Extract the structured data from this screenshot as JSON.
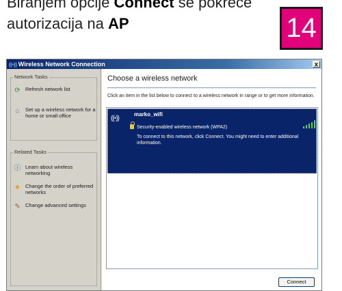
{
  "caption": {
    "line1_pre": "Biranjem opcije ",
    "line1_kw": "Connect",
    "line1_post": " se pokreće",
    "line2_pre": "autorizacija na ",
    "line2_kw": "AP"
  },
  "step_number": "14",
  "window": {
    "title": "Wireless Network Connection",
    "close_glyph": "x"
  },
  "sidebar": {
    "network_tasks": {
      "header": "Network Tasks",
      "items": [
        {
          "label": "Refresh network list",
          "icon": "refresh-icon"
        },
        {
          "label": "Set up a wireless network for a home or small office",
          "icon": "setup-network-icon"
        }
      ]
    },
    "related_tasks": {
      "header": "Related Tasks",
      "items": [
        {
          "label": "Learn about wireless networking",
          "icon": "info-icon"
        },
        {
          "label": "Change the order of preferred networks",
          "icon": "star-icon"
        },
        {
          "label": "Change advanced settings",
          "icon": "advanced-settings-icon"
        }
      ]
    }
  },
  "main": {
    "heading": "Choose a wireless network",
    "instructions": "Click an item in the list below to connect to a wireless network in range or to get more information.",
    "networks": [
      {
        "ssid": "marko_wifi",
        "security": "Security-enabled wireless network (WPA2)",
        "hint": "To connect to this network, click Connect. You might need to enter additional information.",
        "selected": true,
        "signal_level": 1.0
      }
    ],
    "connect_label": "Connect"
  },
  "colors": {
    "badge": "#e2007a",
    "selection": "#0a246a",
    "signal": "#5ad35a",
    "titlebar": "#0a246a"
  }
}
